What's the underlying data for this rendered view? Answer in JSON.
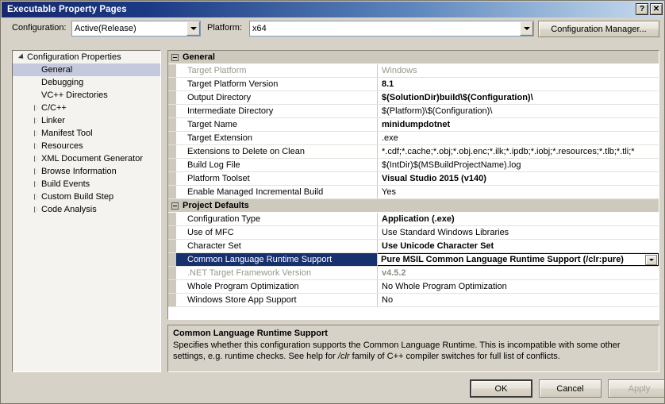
{
  "window": {
    "title": "Executable Property Pages",
    "help_button": "?",
    "close_button": "✕"
  },
  "configbar": {
    "configuration_label": "Configuration:",
    "configuration_value": "Active(Release)",
    "platform_label": "Platform:",
    "platform_value": "x64",
    "config_manager_label": "Configuration Manager..."
  },
  "tree": {
    "items": [
      {
        "label": "Configuration Properties",
        "indent": 0,
        "expander": "open",
        "selected": false
      },
      {
        "label": "General",
        "indent": 1,
        "expander": "none",
        "selected": true
      },
      {
        "label": "Debugging",
        "indent": 1,
        "expander": "none",
        "selected": false
      },
      {
        "label": "VC++ Directories",
        "indent": 1,
        "expander": "none",
        "selected": false
      },
      {
        "label": "C/C++",
        "indent": 1,
        "expander": "closed",
        "selected": false
      },
      {
        "label": "Linker",
        "indent": 1,
        "expander": "closed",
        "selected": false
      },
      {
        "label": "Manifest Tool",
        "indent": 1,
        "expander": "closed",
        "selected": false
      },
      {
        "label": "Resources",
        "indent": 1,
        "expander": "closed",
        "selected": false
      },
      {
        "label": "XML Document Generator",
        "indent": 1,
        "expander": "closed",
        "selected": false
      },
      {
        "label": "Browse Information",
        "indent": 1,
        "expander": "closed",
        "selected": false
      },
      {
        "label": "Build Events",
        "indent": 1,
        "expander": "closed",
        "selected": false
      },
      {
        "label": "Custom Build Step",
        "indent": 1,
        "expander": "closed",
        "selected": false
      },
      {
        "label": "Code Analysis",
        "indent": 1,
        "expander": "closed",
        "selected": false
      }
    ]
  },
  "grid": {
    "groups": [
      {
        "label": "General",
        "expanded": true,
        "rows": [
          {
            "name": "Target Platform",
            "value": "Windows",
            "name_style": "dim",
            "value_style": "dim",
            "selected": false
          },
          {
            "name": "Target Platform Version",
            "value": "8.1",
            "name_style": "normal",
            "value_style": "bold",
            "selected": false
          },
          {
            "name": "Output Directory",
            "value": "$(SolutionDir)build\\$(Configuration)\\",
            "name_style": "normal",
            "value_style": "bold",
            "selected": false
          },
          {
            "name": "Intermediate Directory",
            "value": "$(Platform)\\$(Configuration)\\",
            "name_style": "normal",
            "value_style": "normal",
            "selected": false
          },
          {
            "name": "Target Name",
            "value": "minidumpdotnet",
            "name_style": "normal",
            "value_style": "bold",
            "selected": false
          },
          {
            "name": "Target Extension",
            "value": ".exe",
            "name_style": "normal",
            "value_style": "normal",
            "selected": false
          },
          {
            "name": "Extensions to Delete on Clean",
            "value": "*.cdf;*.cache;*.obj;*.obj.enc;*.ilk;*.ipdb;*.iobj;*.resources;*.tlb;*.tli;*",
            "name_style": "normal",
            "value_style": "normal",
            "selected": false
          },
          {
            "name": "Build Log File",
            "value": "$(IntDir)$(MSBuildProjectName).log",
            "name_style": "normal",
            "value_style": "normal",
            "selected": false
          },
          {
            "name": "Platform Toolset",
            "value": "Visual Studio 2015 (v140)",
            "name_style": "normal",
            "value_style": "bold",
            "selected": false
          },
          {
            "name": "Enable Managed Incremental Build",
            "value": "Yes",
            "name_style": "normal",
            "value_style": "normal",
            "selected": false
          }
        ]
      },
      {
        "label": "Project Defaults",
        "expanded": true,
        "rows": [
          {
            "name": "Configuration Type",
            "value": "Application (.exe)",
            "name_style": "normal",
            "value_style": "bold",
            "selected": false
          },
          {
            "name": "Use of MFC",
            "value": "Use Standard Windows Libraries",
            "name_style": "normal",
            "value_style": "normal",
            "selected": false
          },
          {
            "name": "Character Set",
            "value": "Use Unicode Character Set",
            "name_style": "normal",
            "value_style": "bold",
            "selected": false
          },
          {
            "name": "Common Language Runtime Support",
            "value": "Pure MSIL Common Language Runtime Support (/clr:pure)",
            "name_style": "normal",
            "value_style": "bold",
            "selected": true,
            "has_dropdown": true
          },
          {
            "name": ".NET Target Framework Version",
            "value": "v4.5.2",
            "name_style": "dim",
            "value_style": "dimbold",
            "selected": false
          },
          {
            "name": "Whole Program Optimization",
            "value": "No Whole Program Optimization",
            "name_style": "normal",
            "value_style": "normal",
            "selected": false
          },
          {
            "name": "Windows Store App Support",
            "value": "No",
            "name_style": "normal",
            "value_style": "normal",
            "selected": false
          }
        ]
      }
    ]
  },
  "description": {
    "title": "Common Language Runtime Support",
    "body_part1": "Specifies whether this configuration supports the Common Language Runtime. This is incompatible with some other settings, e.g. runtime checks. See help for ",
    "body_italic": "/clr",
    "body_part2": " family of C++ compiler switches for full list of conflicts."
  },
  "footer": {
    "ok_label": "OK",
    "cancel_label": "Cancel",
    "apply_label": "Apply"
  },
  "colors": {
    "titlebar_start": "#16286e",
    "selection_navy": "#17316f",
    "tree_selection": "#c5c9dd",
    "dialog_face": "#d6d2c7",
    "group_header": "#cec9bd"
  }
}
